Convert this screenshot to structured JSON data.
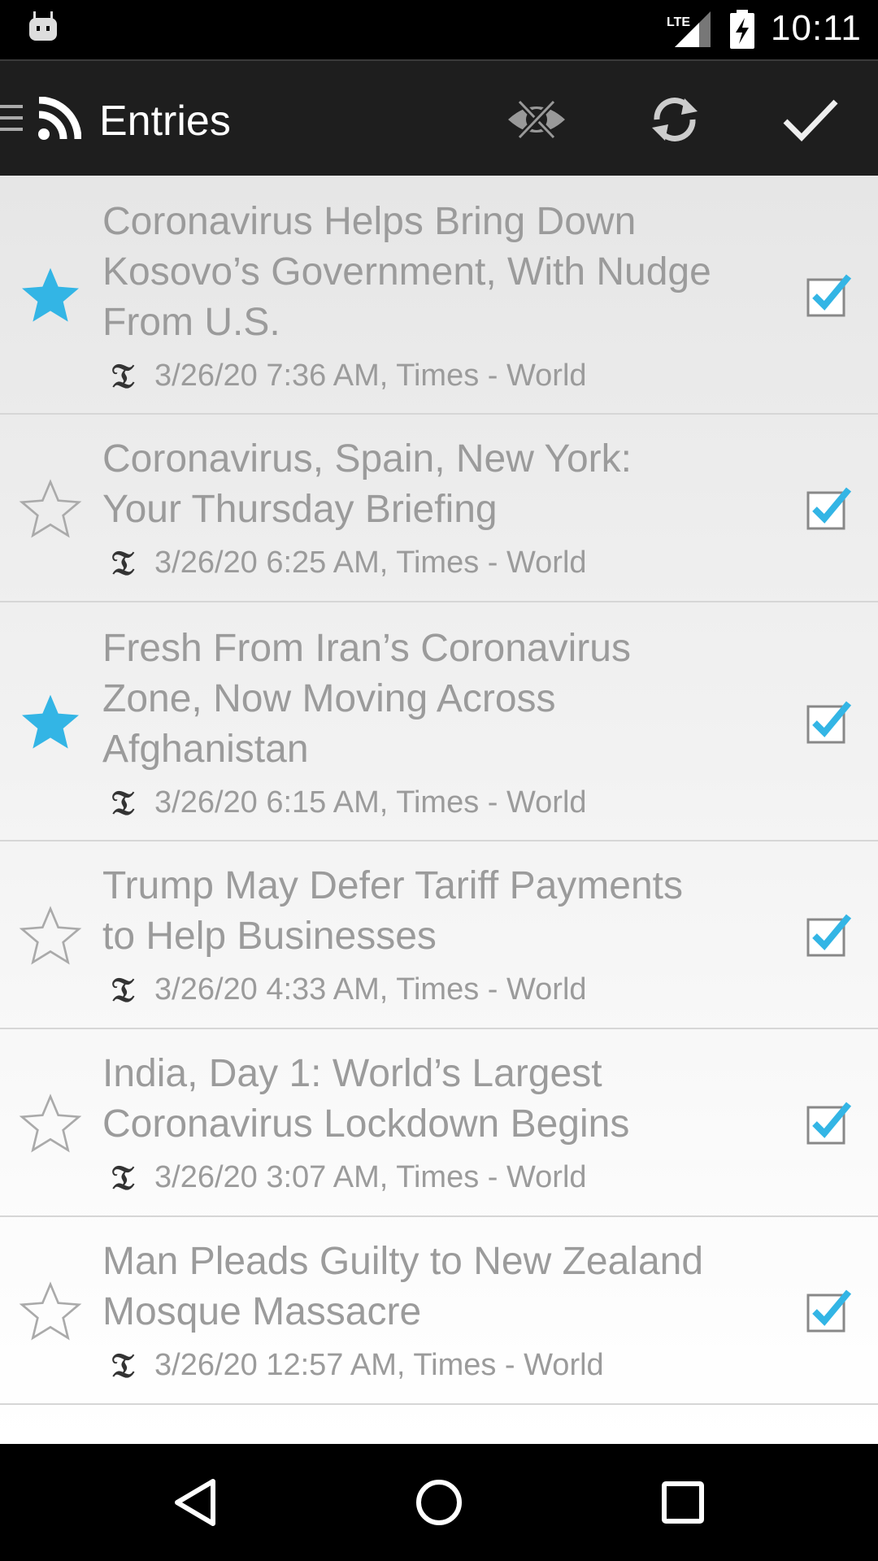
{
  "status_bar": {
    "time": "10:11",
    "network_label": "LTE",
    "icons": [
      "android-icon",
      "lte-signal-icon",
      "battery-charging-icon"
    ]
  },
  "action_bar": {
    "title": "Entries",
    "icons": [
      "menu-icon",
      "rss-icon",
      "hide-read-icon",
      "refresh-icon",
      "mark-read-icon"
    ]
  },
  "entries": [
    {
      "title_lines": [
        "Coronavirus Helps Bring Down",
        "Kosovo’s Government, With Nudge",
        "From U.S."
      ],
      "meta": "3/26/20 7:36 AM, Times - World",
      "starred": true,
      "checked": true
    },
    {
      "title_lines": [
        "Coronavirus, Spain, New York:",
        "Your Thursday Briefing"
      ],
      "meta": "3/26/20 6:25 AM, Times - World",
      "starred": false,
      "checked": true
    },
    {
      "title_lines": [
        "Fresh From Iran’s Coronavirus",
        "Zone, Now Moving Across",
        "Afghanistan"
      ],
      "meta": "3/26/20 6:15 AM, Times - World",
      "starred": true,
      "checked": true
    },
    {
      "title_lines": [
        "Trump May Defer Tariff Payments",
        "to Help Businesses"
      ],
      "meta": "3/26/20 4:33 AM, Times - World",
      "starred": false,
      "checked": true
    },
    {
      "title_lines": [
        "India, Day 1: World’s Largest",
        "Coronavirus Lockdown Begins"
      ],
      "meta": "3/26/20 3:07 AM, Times - World",
      "starred": false,
      "checked": true
    },
    {
      "title_lines": [
        "Man Pleads Guilty to New Zealand",
        "Mosque Massacre"
      ],
      "meta": "3/26/20 12:57 AM, Times - World",
      "starred": false,
      "checked": true
    }
  ],
  "nav_bar": {
    "icons": [
      "back-icon",
      "home-icon",
      "recents-icon"
    ]
  },
  "colors": {
    "star_active": "#33b5e5",
    "check_mark": "#33b5e5",
    "text_muted": "#9b9b9b",
    "action_bar_bg": "#1e1e1e"
  }
}
